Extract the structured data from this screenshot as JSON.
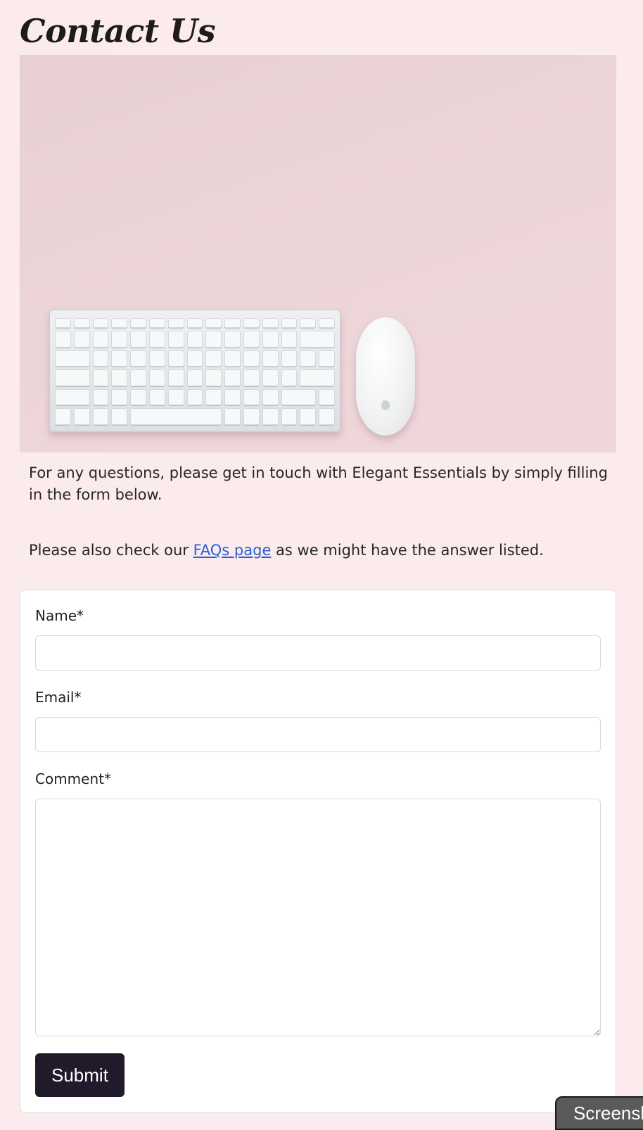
{
  "page": {
    "title": "Contact Us"
  },
  "hero_image": {
    "description_icon": "keyboard-and-mouse-photo"
  },
  "intro": {
    "line1": "For any questions, please get in touch with Elegant Essentials by simply filling in the form below.",
    "line2_before": "Please also check our ",
    "faq_link": "FAQs page",
    "line2_after": " as we might have the answer listed."
  },
  "form": {
    "name_label": "Name*",
    "name_value": "",
    "email_label": "Email*",
    "email_value": "",
    "comment_label": "Comment*",
    "comment_value": "",
    "submit_label": "Submit"
  },
  "floating_button": {
    "label": "Screenshot"
  },
  "colors": {
    "background": "#fcebec",
    "submit_bg": "#201a2b",
    "link": "#2a5fd6"
  }
}
